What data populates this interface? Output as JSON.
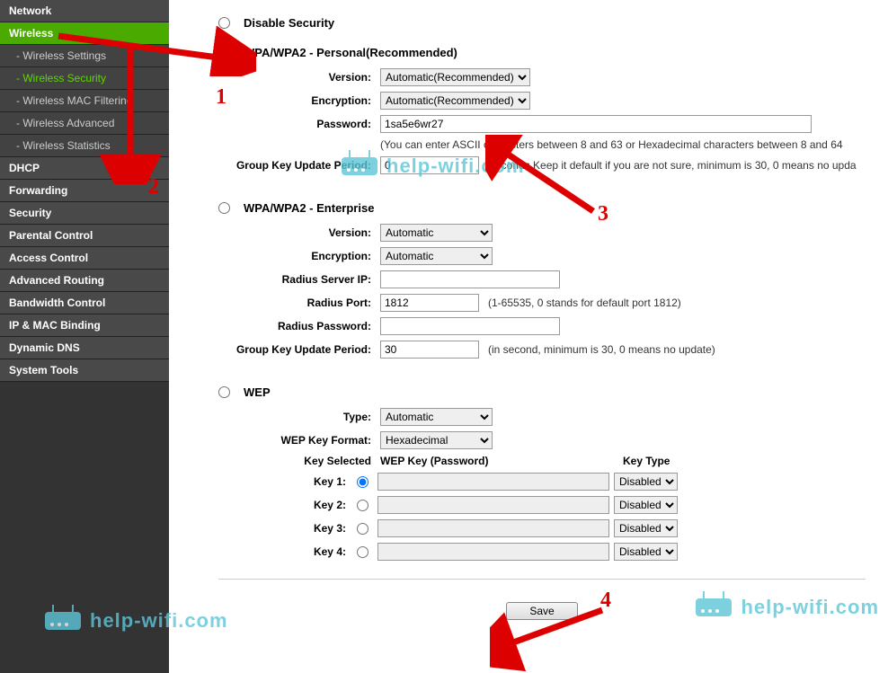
{
  "sidebar": {
    "items": [
      {
        "label": "Network",
        "type": "main"
      },
      {
        "label": "Wireless",
        "type": "main-active"
      },
      {
        "label": "- Wireless Settings",
        "type": "sub"
      },
      {
        "label": "- Wireless Security",
        "type": "sub-active"
      },
      {
        "label": "- Wireless MAC Filtering",
        "type": "sub"
      },
      {
        "label": "- Wireless Advanced",
        "type": "sub"
      },
      {
        "label": "- Wireless Statistics",
        "type": "sub"
      },
      {
        "label": "DHCP",
        "type": "main"
      },
      {
        "label": "Forwarding",
        "type": "main"
      },
      {
        "label": "Security",
        "type": "main"
      },
      {
        "label": "Parental Control",
        "type": "main"
      },
      {
        "label": "Access Control",
        "type": "main"
      },
      {
        "label": "Advanced Routing",
        "type": "main"
      },
      {
        "label": "Bandwidth Control",
        "type": "main"
      },
      {
        "label": "IP & MAC Binding",
        "type": "main"
      },
      {
        "label": "Dynamic DNS",
        "type": "main"
      },
      {
        "label": "System Tools",
        "type": "main"
      }
    ]
  },
  "disable": {
    "title": "Disable Security"
  },
  "personal": {
    "title": "WPA/WPA2 - Personal(Recommended)",
    "version_label": "Version:",
    "version": "Automatic(Recommended)",
    "encryption_label": "Encryption:",
    "encryption": "Automatic(Recommended)",
    "password_label": "Password:",
    "password": "1sa5e6wr27",
    "password_hint": "(You can enter ASCII characters between 8 and 63 or Hexadecimal characters between 8 and 64",
    "gkup_label": "Group Key Update Period:",
    "gkup": "0",
    "gkup_hint": "Seconds Keep it default if you are not sure, minimum is 30, 0 means no upda"
  },
  "enterprise": {
    "title": "WPA/WPA2 - Enterprise",
    "version_label": "Version:",
    "version": "Automatic",
    "encryption_label": "Encryption:",
    "encryption": "Automatic",
    "rip_label": "Radius Server IP:",
    "rip": "",
    "rport_label": "Radius Port:",
    "rport": "1812",
    "rport_hint": "(1-65535, 0 stands for default port 1812)",
    "rpass_label": "Radius Password:",
    "rpass": "",
    "gkup_label": "Group Key Update Period:",
    "gkup": "30",
    "gkup_hint": "(in second, minimum is 30, 0 means no update)"
  },
  "wep": {
    "title": "WEP",
    "type_label": "Type:",
    "type": "Automatic",
    "format_label": "WEP Key Format:",
    "format": "Hexadecimal",
    "key_selected_label": "Key Selected",
    "key_col": "WEP Key (Password)",
    "type_col": "Key Type",
    "keys": [
      {
        "label": "Key 1:",
        "type": "Disabled"
      },
      {
        "label": "Key 2:",
        "type": "Disabled"
      },
      {
        "label": "Key 3:",
        "type": "Disabled"
      },
      {
        "label": "Key 4:",
        "type": "Disabled"
      }
    ]
  },
  "save": "Save",
  "watermark": "help-wifi.com",
  "annotations": {
    "n1": "1",
    "n2": "2",
    "n3": "3",
    "n4": "4"
  }
}
